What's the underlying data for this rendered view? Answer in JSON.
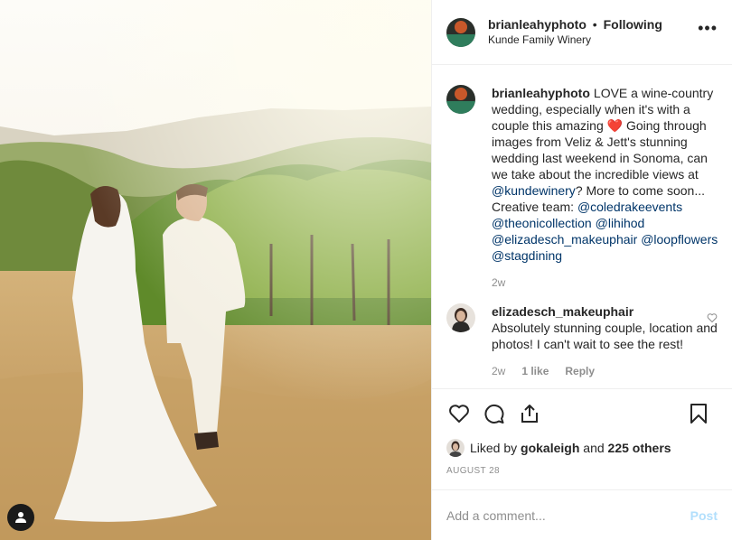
{
  "header": {
    "username": "brianleahyphoto",
    "separator": "•",
    "follow_label": "Following",
    "location": "Kunde Family Winery",
    "more_icon": "more-horizontal-icon"
  },
  "caption": {
    "username": "brianleahyphoto",
    "text_1": "LOVE a wine-country wedding, especially when it's with a couple this amazing",
    "heart": "❤️",
    "text_2": "Going through images from Veliz & Jett's stunning wedding last weekend in Sonoma, can we take about the incredible views at",
    "mention_winery": "@kundewinery",
    "text_3": "? More to come soon... Creative team:",
    "mentions": [
      "@coledrakeevents",
      "@theonicollection",
      "@lihihod",
      "@elizadesch_makeuphair",
      "@loopflowers",
      "@stagdining"
    ],
    "age": "2w"
  },
  "comment": {
    "username": "elizadesch_makeuphair",
    "text": "Absolutely stunning couple, location and photos! I can't wait to see the rest!",
    "age": "2w",
    "likes": "1 like",
    "reply": "Reply"
  },
  "likes": {
    "prefix": "Liked by",
    "user": "gokaleigh",
    "middle": "and",
    "others": "225 others"
  },
  "date": "AUGUST 28",
  "add_comment": {
    "placeholder": "Add a comment...",
    "post_label": "Post"
  },
  "colors": {
    "text": "#262626",
    "muted": "#8e8e8e",
    "link": "#003569",
    "post_disabled": "#b2dffc",
    "heart": "#ed4956"
  }
}
